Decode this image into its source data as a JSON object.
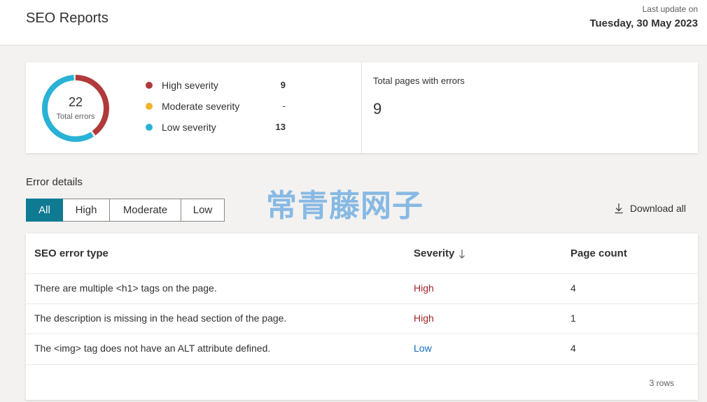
{
  "header": {
    "title": "SEO Reports",
    "last_update_label": "Last update on",
    "last_update_date": "Tuesday, 30 May 2023"
  },
  "summary": {
    "total_errors": "22",
    "total_errors_label": "Total errors",
    "severity_breakdown": [
      {
        "label": "High severity",
        "count": "9",
        "value": 9,
        "color": "#b03a3a"
      },
      {
        "label": "Moderate severity",
        "count": "-",
        "value": 0,
        "color": "#f0b429"
      },
      {
        "label": "Low severity",
        "count": "13",
        "value": 13,
        "color": "#29b2d6"
      }
    ],
    "pages_label": "Total pages with errors",
    "pages_value": "9"
  },
  "details": {
    "title": "Error details",
    "filters": [
      "All",
      "High",
      "Moderate",
      "Low"
    ],
    "active_filter": "All",
    "download_label": "Download all"
  },
  "watermark": "常青藤网子",
  "table": {
    "columns": [
      "SEO error type",
      "Severity",
      "Page count"
    ],
    "sort_column": "Severity",
    "sort_direction": "descending",
    "rows": [
      {
        "error": "There are multiple <h1> tags on the page.",
        "severity": "High",
        "page_count": "4"
      },
      {
        "error": "The description is missing in the head section of the page.",
        "severity": "High",
        "page_count": "1"
      },
      {
        "error": "The <img> tag does not have an ALT attribute defined.",
        "severity": "Low",
        "page_count": "4"
      }
    ],
    "row_count_label": "3 rows"
  },
  "colors": {
    "accent": "#0f7b93",
    "high": "#a4262c",
    "low": "#0f6cbd"
  }
}
